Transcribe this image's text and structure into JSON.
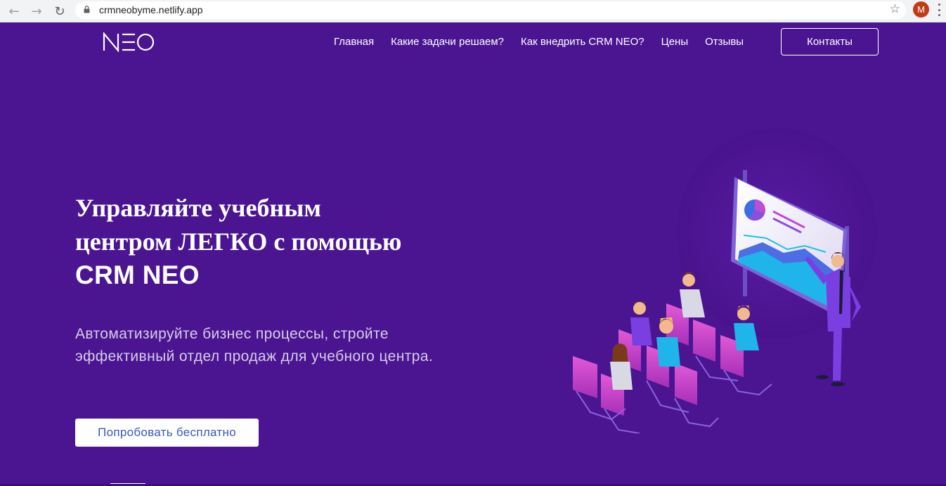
{
  "browser": {
    "back_icon": "arrow-left-icon",
    "forward_icon": "arrow-right-icon",
    "reload_icon": "reload-icon",
    "url": "crmneobyme.netlify.app",
    "profile_initial": "M",
    "profile_color": "#c23b19"
  },
  "header": {
    "logo_text": "NEO",
    "nav": [
      "Главная",
      "Какие задачи решаем?",
      "Как внедрить CRM NEO?",
      "Цены",
      "Отзывы"
    ],
    "contact_label": "Контакты"
  },
  "hero": {
    "title_line1": "Управляйте учебным",
    "title_line2": "центром ЛЕГКО с помощью",
    "title_line3": "CRM NEO",
    "subtitle_line1": "Автоматизируйте бизнес процессы, стройте",
    "subtitle_line2": "эффективный отдел продаж для учебного центра.",
    "cta_label": "Попробовать бесплатно",
    "illustration": "presentation-audience-illustration"
  },
  "colors": {
    "background": "#4b1592",
    "cta_text": "#3c57b9",
    "accent": "#c04bd4"
  }
}
